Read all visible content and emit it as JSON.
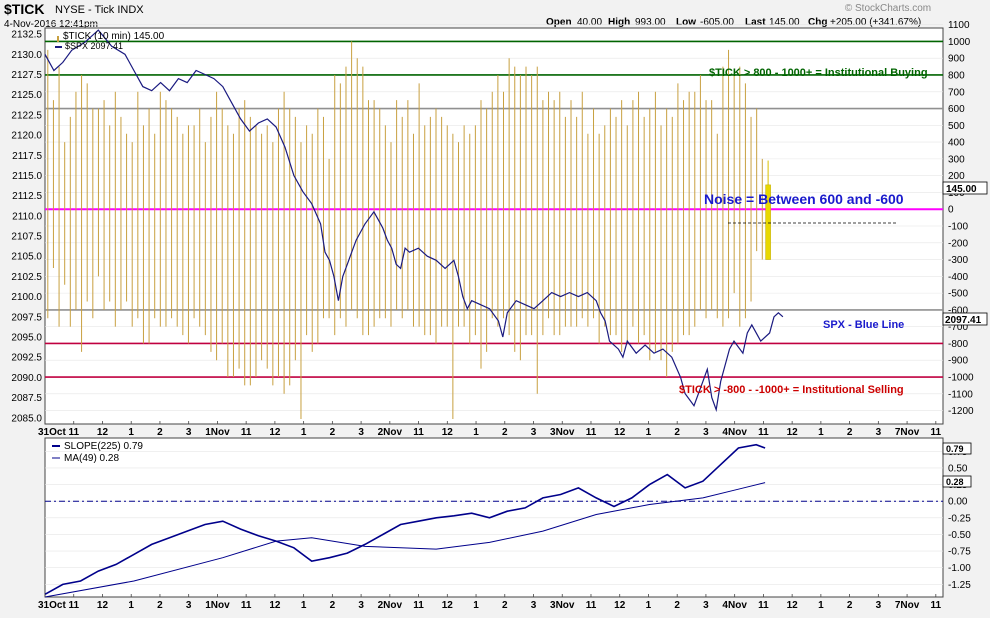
{
  "header": {
    "symbol": "$TICK",
    "exchange_desc": "NYSE - Tick  INDX",
    "datetime": "4-Nov-2016 12:41pm",
    "open_label": "Open",
    "open": "40.00",
    "high_label": "High",
    "high": "993.00",
    "low_label": "Low",
    "low": "-605.00",
    "last_label": "Last",
    "last": "145.00",
    "chg_label": "Chg",
    "chg": "+205.00 (+341.67%)",
    "brand": "© StockCharts.com"
  },
  "legend": {
    "tick": "$TICK (10 min) 145.00",
    "spx": "$SPX 2097.41",
    "slope": "SLOPE(225) 0.79",
    "ma": "MA(49) 0.28"
  },
  "annotations": {
    "buying": "$TICK > 800 - 1000+ = Institutional Buying",
    "noise": "Noise = Between 600 and -600",
    "spx_line": "SPX - Blue Line",
    "selling": "$TICK > -800 - -1000+ = Institutional Selling"
  },
  "badges": {
    "tick_last": "145.00",
    "spx_last": "2097.41",
    "slope_last": "0.79",
    "ma_last": "0.28"
  },
  "colors": {
    "background": "#f2f2f2",
    "panel": "#ffffff",
    "tick_bars": "#c8a040",
    "spx_line": "#1a1a80",
    "green_line": "#006400",
    "gray_line": "#909090",
    "magenta_line": "#ff00ff",
    "red_line": "#c00040",
    "slope_line": "#00008b",
    "noise_text": "#1a1acc",
    "sell_text": "#cc0000"
  },
  "chart_data": [
    {
      "type": "bar",
      "name": "$TICK (10 min)",
      "y_axis_right": {
        "range": [
          -1280,
          1080
        ],
        "ticks": [
          1100,
          1000,
          900,
          800,
          700,
          600,
          500,
          400,
          300,
          200,
          100,
          0,
          -100,
          -200,
          -300,
          -400,
          -500,
          -600,
          -700,
          -800,
          -900,
          -1000,
          -1100,
          -1200
        ]
      },
      "y_axis_left": {
        "range": [
          2084.23,
          2133.26
        ],
        "ticks": [
          2132.5,
          2130.0,
          2127.5,
          2125.0,
          2122.5,
          2120.0,
          2117.5,
          2115.0,
          2112.5,
          2110.0,
          2107.5,
          2105.0,
          2102.5,
          2100.0,
          2097.5,
          2095.0,
          2092.5,
          2090.0,
          2087.5,
          2085.0
        ]
      },
      "x_tick_labels": [
        "31Oct",
        "11",
        "12",
        "1",
        "2",
        "3",
        "1Nov",
        "11",
        "12",
        "1",
        "2",
        "3",
        "2Nov",
        "11",
        "12",
        "1",
        "2",
        "3",
        "3Nov",
        "11",
        "12",
        "1",
        "2",
        "3",
        "4Nov",
        "11",
        "12",
        "1",
        "2",
        "3",
        "7Nov",
        "11"
      ],
      "reference_lines": [
        {
          "value": 1000,
          "color": "green"
        },
        {
          "value": 800,
          "color": "green"
        },
        {
          "value": 600,
          "color": "gray"
        },
        {
          "value": 0,
          "color": "magenta"
        },
        {
          "value": -600,
          "color": "gray"
        },
        {
          "value": -800,
          "color": "red"
        },
        {
          "value": -1000,
          "color": "red"
        }
      ],
      "tick_highs": [
        950,
        650,
        850,
        400,
        550,
        700,
        800,
        750,
        600,
        600,
        650,
        500,
        700,
        550,
        450,
        400,
        700,
        500,
        600,
        450,
        700,
        650,
        600,
        550,
        450,
        500,
        500,
        600,
        400,
        550,
        700,
        600,
        500,
        450,
        600,
        650,
        550,
        500,
        450,
        500,
        400,
        600,
        700,
        600,
        550,
        400,
        500,
        450,
        600,
        550,
        300,
        800,
        750,
        850,
        1000,
        900,
        850,
        650,
        650,
        600,
        500,
        400,
        650,
        550,
        650,
        450,
        750,
        500,
        550,
        600,
        550,
        500,
        450,
        400,
        500,
        450,
        500,
        650,
        600,
        700,
        800,
        700,
        900,
        850,
        800,
        850,
        800,
        850,
        650,
        700,
        650,
        700,
        550,
        650,
        550,
        700,
        450,
        600,
        450,
        500,
        600,
        550,
        650,
        500,
        650,
        700,
        550,
        600,
        700,
        500,
        600,
        550,
        750,
        650,
        700,
        700,
        800,
        650,
        650,
        450,
        850,
        950,
        800,
        850,
        750,
        550,
        600,
        300
      ],
      "tick_lows": [
        -650,
        -350,
        -700,
        -450,
        -700,
        -600,
        -850,
        -550,
        -650,
        -400,
        -600,
        -550,
        -700,
        -600,
        -550,
        -700,
        -650,
        -800,
        -800,
        -650,
        -700,
        -700,
        -650,
        -700,
        -750,
        -800,
        -650,
        -700,
        -750,
        -850,
        -900,
        -800,
        -1000,
        -1000,
        -950,
        -1050,
        -1050,
        -1000,
        -900,
        -950,
        -1050,
        -1000,
        -1100,
        -1050,
        -900,
        -1250,
        -750,
        -850,
        -800,
        -650,
        -650,
        -750,
        -650,
        -700,
        -600,
        -650,
        -750,
        -750,
        -700,
        -650,
        -650,
        -700,
        -600,
        -650,
        -600,
        -700,
        -700,
        -750,
        -750,
        -800,
        -700,
        -700,
        -1250,
        -700,
        -700,
        -800,
        -750,
        -950,
        -850,
        -650,
        -700,
        -650,
        -750,
        -850,
        -900,
        -750,
        -750,
        -1100,
        -750,
        -650,
        -750,
        -750,
        -700,
        -700,
        -700,
        -650,
        -700,
        -650,
        -800,
        -700,
        -750,
        -750,
        -850,
        -800,
        -700,
        -800,
        -750,
        -900,
        -850,
        -900,
        -1000,
        -850,
        -800,
        -750,
        -750,
        -700,
        -600,
        -650,
        -600,
        -650,
        -700,
        -650,
        -500,
        -700,
        -650,
        -550,
        -250,
        -300
      ],
      "tick_last": {
        "open": 40,
        "close": 145,
        "high": 290,
        "low": -300
      }
    },
    {
      "type": "line",
      "name": "$SPX",
      "points": [
        [
          0,
          2130.0
        ],
        [
          0.01,
          2128.0
        ],
        [
          0.02,
          2129.0
        ],
        [
          0.03,
          2130.5
        ],
        [
          0.045,
          2131.5
        ],
        [
          0.06,
          2133.0
        ],
        [
          0.075,
          2131.0
        ],
        [
          0.09,
          2130.0
        ],
        [
          0.1,
          2128.0
        ],
        [
          0.11,
          2126.0
        ],
        [
          0.12,
          2125.5
        ],
        [
          0.13,
          2126.5
        ],
        [
          0.14,
          2125.5
        ],
        [
          0.15,
          2127.0
        ],
        [
          0.16,
          2126.5
        ],
        [
          0.17,
          2128.0
        ],
        [
          0.18,
          2127.5
        ],
        [
          0.19,
          2127.0
        ],
        [
          0.2,
          2126.0
        ],
        [
          0.21,
          2124.0
        ],
        [
          0.22,
          2122.0
        ],
        [
          0.23,
          2120.5
        ],
        [
          0.24,
          2121.5
        ],
        [
          0.25,
          2122.0
        ],
        [
          0.26,
          2121.0
        ],
        [
          0.27,
          2118.5
        ],
        [
          0.28,
          2115.0
        ],
        [
          0.29,
          2113.0
        ],
        [
          0.3,
          2111.5
        ],
        [
          0.31,
          2109.0
        ],
        [
          0.315,
          2105.5
        ],
        [
          0.32,
          2104.5
        ],
        [
          0.325,
          2102.5
        ],
        [
          0.33,
          2099.5
        ],
        [
          0.335,
          2102.5
        ],
        [
          0.34,
          2104.0
        ],
        [
          0.345,
          2105.5
        ],
        [
          0.35,
          2107.0
        ],
        [
          0.36,
          2109.0
        ],
        [
          0.37,
          2110.5
        ],
        [
          0.375,
          2109.5
        ],
        [
          0.38,
          2108.5
        ],
        [
          0.385,
          2107.0
        ],
        [
          0.39,
          2106.0
        ],
        [
          0.395,
          2104.0
        ],
        [
          0.4,
          2103.5
        ],
        [
          0.405,
          2106.0
        ],
        [
          0.41,
          2105.5
        ],
        [
          0.42,
          2106.0
        ],
        [
          0.43,
          2105.0
        ],
        [
          0.44,
          2104.5
        ],
        [
          0.45,
          2103.5
        ],
        [
          0.46,
          2104.5
        ],
        [
          0.465,
          2102.5
        ],
        [
          0.47,
          2100.0
        ],
        [
          0.475,
          2098.5
        ],
        [
          0.48,
          2099.5
        ],
        [
          0.49,
          2099.0
        ],
        [
          0.5,
          2098.5
        ],
        [
          0.51,
          2097.0
        ],
        [
          0.515,
          2095.0
        ],
        [
          0.52,
          2098.0
        ],
        [
          0.53,
          2099.5
        ],
        [
          0.54,
          2099.0
        ],
        [
          0.55,
          2098.5
        ],
        [
          0.56,
          2099.5
        ],
        [
          0.57,
          2100.5
        ],
        [
          0.58,
          2100.0
        ],
        [
          0.59,
          2100.5
        ],
        [
          0.6,
          2100.0
        ],
        [
          0.61,
          2100.5
        ],
        [
          0.62,
          2099.5
        ],
        [
          0.625,
          2098.0
        ],
        [
          0.63,
          2097.0
        ],
        [
          0.635,
          2094.5
        ],
        [
          0.645,
          2093.5
        ],
        [
          0.65,
          2092.5
        ],
        [
          0.655,
          2094.5
        ],
        [
          0.665,
          2093.0
        ],
        [
          0.675,
          2094.0
        ],
        [
          0.685,
          2093.0
        ],
        [
          0.695,
          2093.5
        ],
        [
          0.705,
          2092.5
        ],
        [
          0.715,
          2090.0
        ],
        [
          0.72,
          2088.0
        ],
        [
          0.73,
          2086.5
        ],
        [
          0.74,
          2089.5
        ],
        [
          0.745,
          2091.0
        ],
        [
          0.75,
          2087.5
        ],
        [
          0.755,
          2086.0
        ],
        [
          0.76,
          2089.5
        ],
        [
          0.77,
          2093.5
        ],
        [
          0.775,
          2094.5
        ],
        [
          0.785,
          2093.0
        ],
        [
          0.79,
          2095.5
        ],
        [
          0.795,
          2096.5
        ],
        [
          0.805,
          2094.5
        ],
        [
          0.815,
          2095.5
        ],
        [
          0.82,
          2097.5
        ],
        [
          0.825,
          2098.0
        ],
        [
          0.83,
          2097.5
        ]
      ]
    },
    {
      "type": "line",
      "name": "SLOPE(225) / MA(49)",
      "y_axis_right": {
        "range": [
          -1.44,
          0.95
        ],
        "ticks": [
          0.75,
          0.5,
          0.25,
          0.0,
          -0.25,
          -0.5,
          -0.75,
          -1.0,
          -1.25
        ]
      },
      "zero_line": 0,
      "series": [
        {
          "name": "SLOPE(225)",
          "points": [
            [
              0,
              -1.4
            ],
            [
              0.02,
              -1.25
            ],
            [
              0.04,
              -1.2
            ],
            [
              0.06,
              -1.05
            ],
            [
              0.08,
              -0.95
            ],
            [
              0.1,
              -0.8
            ],
            [
              0.12,
              -0.65
            ],
            [
              0.14,
              -0.55
            ],
            [
              0.16,
              -0.45
            ],
            [
              0.18,
              -0.35
            ],
            [
              0.2,
              -0.3
            ],
            [
              0.22,
              -0.42
            ],
            [
              0.24,
              -0.52
            ],
            [
              0.26,
              -0.6
            ],
            [
              0.28,
              -0.7
            ],
            [
              0.3,
              -0.9
            ],
            [
              0.32,
              -0.85
            ],
            [
              0.34,
              -0.78
            ],
            [
              0.36,
              -0.65
            ],
            [
              0.38,
              -0.5
            ],
            [
              0.4,
              -0.35
            ],
            [
              0.42,
              -0.3
            ],
            [
              0.44,
              -0.25
            ],
            [
              0.46,
              -0.22
            ],
            [
              0.48,
              -0.18
            ],
            [
              0.5,
              -0.25
            ],
            [
              0.52,
              -0.15
            ],
            [
              0.54,
              -0.1
            ],
            [
              0.56,
              0.05
            ],
            [
              0.58,
              0.1
            ],
            [
              0.6,
              0.2
            ],
            [
              0.62,
              0.05
            ],
            [
              0.64,
              -0.08
            ],
            [
              0.66,
              0.05
            ],
            [
              0.68,
              0.25
            ],
            [
              0.7,
              0.4
            ],
            [
              0.72,
              0.2
            ],
            [
              0.74,
              0.3
            ],
            [
              0.76,
              0.55
            ],
            [
              0.78,
              0.8
            ],
            [
              0.8,
              0.85
            ],
            [
              0.81,
              0.8
            ]
          ]
        },
        {
          "name": "MA(49)",
          "points": [
            [
              0,
              -1.44
            ],
            [
              0.1,
              -1.2
            ],
            [
              0.2,
              -0.85
            ],
            [
              0.26,
              -0.6
            ],
            [
              0.3,
              -0.55
            ],
            [
              0.36,
              -0.68
            ],
            [
              0.44,
              -0.72
            ],
            [
              0.5,
              -0.62
            ],
            [
              0.56,
              -0.45
            ],
            [
              0.62,
              -0.2
            ],
            [
              0.68,
              -0.05
            ],
            [
              0.74,
              0.05
            ],
            [
              0.78,
              0.18
            ],
            [
              0.81,
              0.28
            ]
          ]
        }
      ]
    }
  ]
}
